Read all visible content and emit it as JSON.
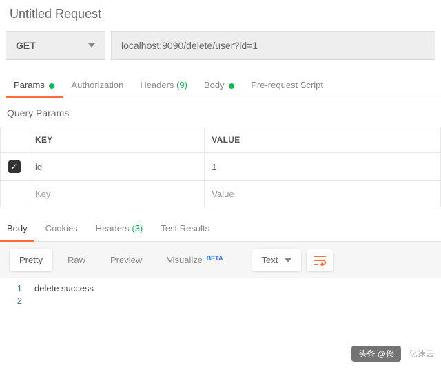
{
  "title": "Untitled Request",
  "request": {
    "method": "GET",
    "url": "localhost:9090/delete/user?id=1"
  },
  "tabs": {
    "params": "Params",
    "auth": "Authorization",
    "headers": "Headers",
    "headers_count": "(9)",
    "body": "Body",
    "prereq": "Pre-request Script"
  },
  "query": {
    "title": "Query Params",
    "key_header": "KEY",
    "value_header": "VALUE",
    "rows": [
      {
        "key": "id",
        "value": "1"
      }
    ],
    "key_placeholder": "Key",
    "value_placeholder": "Value"
  },
  "resp_tabs": {
    "body": "Body",
    "cookies": "Cookies",
    "headers": "Headers",
    "headers_count": "(3)",
    "tests": "Test Results"
  },
  "toolbar": {
    "pretty": "Pretty",
    "raw": "Raw",
    "preview": "Preview",
    "visualize": "Visualize",
    "beta": "BETA",
    "format": "Text"
  },
  "response_lines": [
    "delete success",
    ""
  ],
  "watermark": {
    "left": "头条 @修",
    "right": "亿速云"
  }
}
